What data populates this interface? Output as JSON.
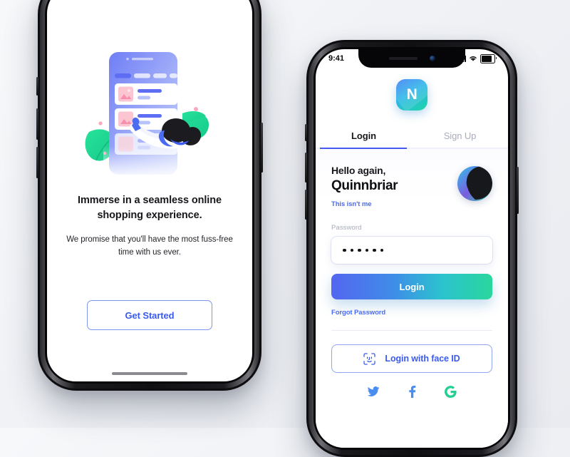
{
  "onboarding": {
    "headline": "Immerse in a seamless online shopping experience.",
    "subcopy": "We promise that you'll have the most fuss-free time with us ever.",
    "cta_label": "Get Started",
    "illustration_name": "shopping-app-illustration"
  },
  "login_screen": {
    "status_bar": {
      "time": "9:41",
      "signal_icon": "signal-bars-icon",
      "wifi_icon": "wifi-icon",
      "battery_icon": "battery-icon"
    },
    "logo": {
      "letter": "N",
      "gradient_from": "#3d7df5",
      "gradient_mid": "#29b6e8",
      "gradient_to": "#1fd6a5"
    },
    "tabs": [
      {
        "label": "Login",
        "active": true
      },
      {
        "label": "Sign Up",
        "active": false
      }
    ],
    "tab_indicator_color": "#4458f2",
    "greeting_line1": "Hello again,",
    "greeting_name": "Quinnbriar",
    "not_me_label": "This isn't me",
    "avatar_name": "user-avatar",
    "password": {
      "label": "Password",
      "value": "••••••",
      "dot_count": 6
    },
    "login_button": {
      "label": "Login",
      "gradient_from": "#5466f0",
      "gradient_to": "#2ad79c"
    },
    "forgot_label": "Forgot Password",
    "face_id": {
      "label": "Login with face ID",
      "icon": "face-id-icon"
    },
    "socials": [
      {
        "name": "twitter-icon",
        "color": "#4a8df0"
      },
      {
        "name": "facebook-icon",
        "color": "#4a8df0"
      },
      {
        "name": "google-icon",
        "color": "#24cf93"
      }
    ],
    "link_color": "#4a6bf2"
  }
}
